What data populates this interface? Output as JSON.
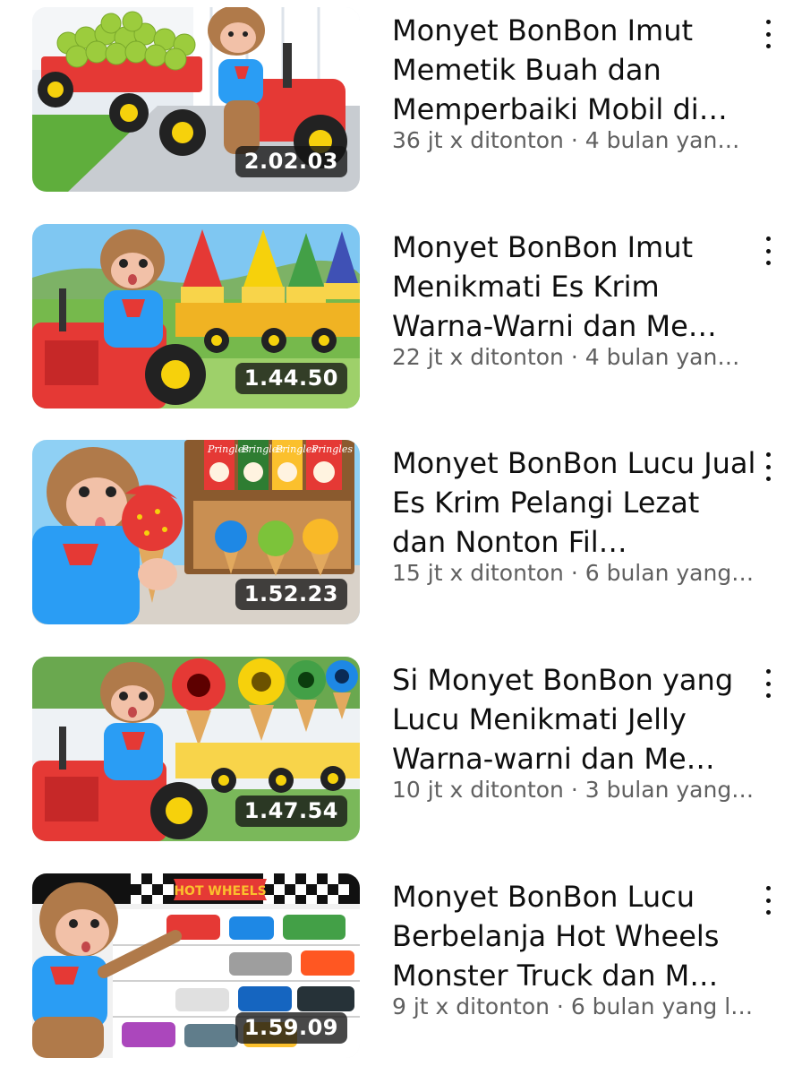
{
  "videos": [
    {
      "title": "Monyet BonBon Imut Memetik Buah dan Memperbaiki Mobil di…",
      "views": "36 jt x ditonton",
      "age": "4 bulan yan…",
      "stats_line": "36 jt x ditonton · 4 bulan yan…",
      "duration": "2.02.03"
    },
    {
      "title": "Monyet BonBon Imut Menikmati Es Krim Warna-Warni dan Me…",
      "views": "22 jt x ditonton",
      "age": "4 bulan yan…",
      "stats_line": "22 jt x ditonton · 4 bulan yan…",
      "duration": "1.44.50"
    },
    {
      "title": "Monyet BonBon Lucu Jual Es Krim Pelangi Lezat dan Nonton Fil…",
      "views": "15 jt x ditonton",
      "age": "6 bulan yang…",
      "stats_line": "15 jt x ditonton · 6 bulan yang…",
      "duration": "1.52.23"
    },
    {
      "title": "Si Monyet BonBon yang Lucu Menikmati Jelly Warna-warni dan Me…",
      "views": "10 jt x ditonton",
      "age": "3 bulan yang…",
      "stats_line": "10 jt x ditonton · 3 bulan yang…",
      "duration": "1.47.54"
    },
    {
      "title": "Monyet BonBon Lucu Berbelanja Hot Wheels Monster Truck dan M…",
      "views": "9 jt x ditonton",
      "age": "6 bulan yang l…",
      "stats_line": "9 jt x ditonton · 6 bulan yang l…",
      "duration": "1.59.09"
    }
  ],
  "thumb_text": {
    "pringles": "Pringles",
    "hotwheels": "HOT WHEELS"
  },
  "icons": {
    "more": "more-vert-icon"
  },
  "colors": {
    "title": "#0f0f0f",
    "meta": "#606060",
    "duration_bg": "#141414"
  }
}
